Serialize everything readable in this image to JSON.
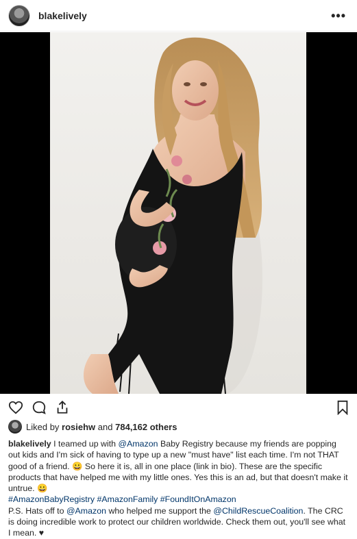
{
  "post": {
    "username": "blakelively",
    "more_label": "•••",
    "liked_by_prefix": "Liked by",
    "liked_by_user": "rosiehw",
    "liked_by_and": "and",
    "likes_count": "784,162 others"
  },
  "icons": {
    "like": "heart-icon",
    "comment": "comment-icon",
    "share": "share-icon",
    "save": "bookmark-icon",
    "more": "more-icon"
  },
  "caption": {
    "author": "blakelively",
    "t1": "I teamed up with",
    "m1": "@Amazon",
    "t2": "Baby Registry because my friends are popping out kids and I'm sick of having to type up a new \"must have\" list each time. I'm not THAT good of a friend. 😀 So here it is, all in one place (link in bio). These are the specific products that have helped me with my little ones. Yes this is an ad, but that doesn't make it untrue. 😀",
    "h1": "#AmazonBabyRegistry",
    "h2": "#AmazonFamily",
    "h3": "#FoundItOnAmazon",
    "t3": "P.S. Hats off to",
    "m2": "@Amazon",
    "t4": "who helped me support the",
    "m3": "@ChildRescueCoalition",
    "t5": ". The CRC is doing incredible work to protect our children worldwide. Check them out, you'll see what I mean. ♥"
  },
  "colors": {
    "link": "#003569",
    "text": "#262626",
    "photo_bg": "#000000"
  }
}
